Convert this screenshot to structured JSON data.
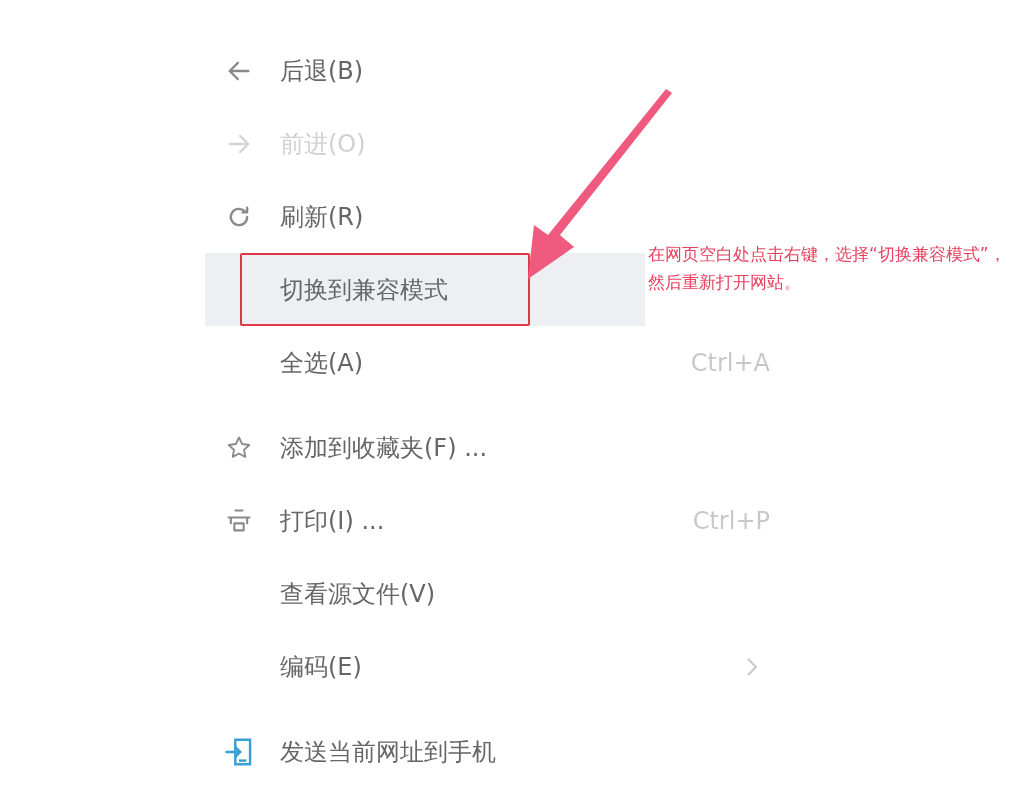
{
  "menu": {
    "groups": [
      [
        {
          "label": "后退(B)",
          "disabled": false,
          "selected": false
        },
        {
          "label": "前进(O)",
          "disabled": true,
          "selected": false
        },
        {
          "label": "刷新(R)",
          "disabled": false,
          "selected": false
        },
        {
          "label": "切换到兼容模式",
          "disabled": false,
          "selected": true
        },
        {
          "label": "全选(A)",
          "shortcut": "Ctrl+A",
          "disabled": false,
          "selected": false
        }
      ],
      [
        {
          "label": "添加到收藏夹(F) ...",
          "disabled": false,
          "selected": false
        },
        {
          "label": "打印(I) ...",
          "shortcut": "Ctrl+P",
          "disabled": false,
          "selected": false
        },
        {
          "label": "查看源文件(V)",
          "disabled": false,
          "selected": false
        },
        {
          "label": "编码(E)",
          "submenu": true,
          "disabled": false,
          "selected": false
        }
      ],
      [
        {
          "label": "发送当前网址到手机",
          "disabled": false,
          "selected": false
        }
      ]
    ]
  },
  "annotation": {
    "note": "在网页空白处点击右键，选择“切换兼容模式”，然后重新打开网站。"
  }
}
